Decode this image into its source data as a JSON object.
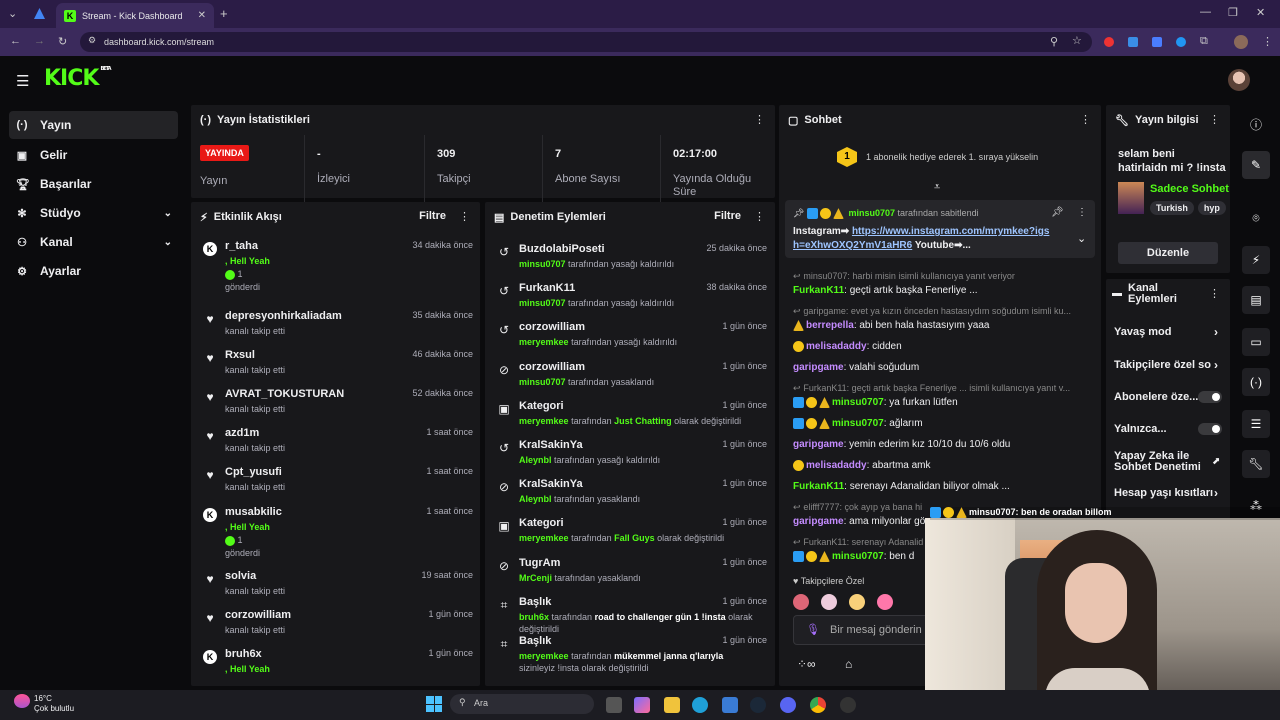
{
  "browser": {
    "tab_title": "Stream - Kick Dashboard",
    "url": "dashboard.kick.com/stream"
  },
  "logo": {
    "text": "KICK",
    "beta": "BETA"
  },
  "sidebar": {
    "items": [
      {
        "label": "Yayın",
        "icon": "broadcast-icon",
        "active": true
      },
      {
        "label": "Gelir",
        "icon": "wallet-icon"
      },
      {
        "label": "Başarılar",
        "icon": "trophy-icon"
      },
      {
        "label": "Stüdyo",
        "icon": "gear-icon",
        "expandable": true
      },
      {
        "label": "Kanal",
        "icon": "user-group-icon",
        "expandable": true
      },
      {
        "label": "Ayarlar",
        "icon": "settings-icon",
        "expandable": true
      }
    ]
  },
  "stats": {
    "title": "Yayın İstatistikleri",
    "live_badge": "YAYINDA",
    "items": [
      {
        "value": "",
        "label": "Yayın"
      },
      {
        "value": "-",
        "label": "İzleyici"
      },
      {
        "value": "309",
        "label": "Takipçi"
      },
      {
        "value": "7",
        "label": "Abone Sayısı"
      },
      {
        "value": "02:17:00",
        "label": "Yayında Olduğu Süre"
      }
    ]
  },
  "activity": {
    "title": "Etkinlik Akışı",
    "filter": "Filtre",
    "events": [
      {
        "name": "r_taha",
        "time": "34 dakika önce",
        "sub": ", Hell Yeah",
        "extra": "1",
        "extra2": "gönderdi",
        "icon": "kick-icon"
      },
      {
        "name": "depresyonhirkaliadam",
        "time": "35 dakika önce",
        "sub": "kanalı takip etti",
        "icon": "heart-icon"
      },
      {
        "name": "Rxsul",
        "time": "46 dakika önce",
        "sub": "kanalı takip etti",
        "icon": "heart-icon"
      },
      {
        "name": "AVRAT_TOKUSTURAN",
        "time": "52 dakika önce",
        "sub": "kanalı takip etti",
        "icon": "heart-icon"
      },
      {
        "name": "azd1m",
        "time": "1 saat önce",
        "sub": "kanalı takip etti",
        "icon": "heart-icon"
      },
      {
        "name": "Cpt_yusufi",
        "time": "1 saat önce",
        "sub": "kanalı takip etti",
        "icon": "heart-icon"
      },
      {
        "name": "musabkilic",
        "time": "1 saat önce",
        "sub": ", Hell Yeah",
        "extra": "1",
        "extra2": "gönderdi",
        "icon": "kick-icon"
      },
      {
        "name": "solvia",
        "time": "19 saat önce",
        "sub": "kanalı takip etti",
        "icon": "heart-icon"
      },
      {
        "name": "corzowilliam",
        "time": "1 gün önce",
        "sub": "kanalı takip etti",
        "icon": "heart-icon"
      },
      {
        "name": "bruh6x",
        "time": "1 gün önce",
        "sub": ", Hell Yeah",
        "icon": "kick-icon"
      }
    ]
  },
  "moderation": {
    "title": "Denetim Eylemleri",
    "filter": "Filtre",
    "actions": [
      {
        "name": "BuzdolabiPoseti",
        "time": "25 dakika önce",
        "actor": "minsu0707",
        "text": "tarafından yasağı kaldırıldı",
        "icon": "undo-icon"
      },
      {
        "name": "FurkanK11",
        "time": "38 dakika önce",
        "actor": "minsu0707",
        "text": "tarafından yasağı kaldırıldı",
        "icon": "undo-icon"
      },
      {
        "name": "corzowilliam",
        "time": "1 gün önce",
        "actor": "meryemkee",
        "text": "tarafından yasağı kaldırıldı",
        "icon": "undo-icon"
      },
      {
        "name": "corzowilliam",
        "time": "1 gün önce",
        "actor": "minsu0707",
        "text": "tarafından yasaklandı",
        "icon": "ban-icon"
      },
      {
        "name": "Kategori",
        "time": "1 gün önce",
        "actor": "meryemkee",
        "text": "tarafından",
        "hl": "Just Chatting",
        "text2": "olarak değiştirildi",
        "icon": "category-icon"
      },
      {
        "name": "KralSakinYa",
        "time": "1 gün önce",
        "actor": "Aleynbl",
        "text": "tarafından yasağı kaldırıldı",
        "icon": "undo-icon"
      },
      {
        "name": "KralSakinYa",
        "time": "1 gün önce",
        "actor": "Aleynbl",
        "text": "tarafından yasaklandı",
        "icon": "ban-icon"
      },
      {
        "name": "Kategori",
        "time": "1 gün önce",
        "actor": "meryemkee",
        "text": "tarafından",
        "hl": "Fall Guys",
        "text2": "olarak değiştirildi",
        "icon": "category-icon"
      },
      {
        "name": "TugrAm",
        "time": "1 gün önce",
        "actor": "MrCenji",
        "text": "tarafından yasaklandı",
        "icon": "ban-icon"
      },
      {
        "name": "Başlık",
        "time": "1 gün önce",
        "actor": "bruh6x",
        "text": "tarafından",
        "hl": "road to challenger gün 1 !insta",
        "text2": "olarak",
        "line2": "değiştirildi",
        "icon": "title-icon"
      },
      {
        "name": "Başlık",
        "time": "1 gün önce",
        "actor": "meryemkee",
        "text": "tarafından",
        "hl": "mükemmel janna q'larıyla",
        "text2": "",
        "line2": "sizinleyiz !insta olarak değiştirildi",
        "icon": "title-icon"
      }
    ]
  },
  "chat": {
    "title": "Sohbet",
    "gift_notice": "1 abonelik hediye ederek 1. sıraya yükselin",
    "pinned_by": "minsu0707",
    "pinned_text": "tarafından sabitlendi",
    "pinned_msg_prefix": "Instagram➡",
    "pinned_link": "https://www.instagram.com/mrymkee?igsh=eXhwOXQ2YmV1aHR6",
    "pinned_suffix": "Youtube➡...",
    "lines": [
      {
        "reply": "minsu0707: harbi misin isimli kullanıcıya yanıt veriyor"
      },
      {
        "user": "FurkanK11",
        "color": "#53fc18",
        "msg": "geçti artık başka Fenerliye ..."
      },
      {
        "reply": "garipgame: evet ya kızın önceden hastasıydım soğudum isimli ku..."
      },
      {
        "user": "berrepella",
        "color": "#c48cff",
        "msg": "abi ben hala hastasıyım yaaa",
        "badges": [
          "warn"
        ]
      },
      {
        "user": "melisadaddy",
        "color": "#c48cff",
        "msg": "cidden",
        "badges": [
          "crown"
        ]
      },
      {
        "user": "garipgame",
        "color": "#c48cff",
        "msg": "valahi soğudum"
      },
      {
        "reply": "FurkanK11: geçti artık başka Fenerliye ... isimli kullanıcıya yanıt v..."
      },
      {
        "user": "minsu0707",
        "color": "#53fc18",
        "msg": "ya furkan lütfen",
        "badges": [
          "mod",
          "gold",
          "warn"
        ]
      },
      {
        "user": "minsu0707",
        "color": "#53fc18",
        "msg": "ağlarım",
        "badges": [
          "mod",
          "gold",
          "warn"
        ]
      },
      {
        "user": "garipgame",
        "color": "#c48cff",
        "msg": "yemin ederim kız 10/10 du 10/6 oldu"
      },
      {
        "user": "melisadaddy",
        "color": "#c48cff",
        "msg": "abartma amk",
        "badges": [
          "crown"
        ]
      },
      {
        "user": "FurkanK11",
        "color": "#53fc18",
        "msg": "serenayı Adanalidan biliyor olmak ..."
      },
      {
        "reply": "elifff7777: çok ayıp ya bana hi"
      },
      {
        "user": "garipgame",
        "color": "#c48cff",
        "msg": "ama milyonlar gö"
      },
      {
        "reply": "FurkanK11: serenayı Adanalid"
      },
      {
        "user": "minsu0707",
        "color": "#53fc18",
        "msg": "ben d",
        "badges": [
          "mod",
          "gold",
          "warn"
        ]
      }
    ],
    "followers_only": "Takipçilere Özel",
    "input_placeholder": "Bir mesaj gönderin",
    "overlay_user": "minsu0707",
    "overlay_msg": ": ben de oradan billom"
  },
  "stream_info": {
    "title": "Yayın bilgisi",
    "stream_title": "selam beni hatirlaidn mi ? !insta",
    "category": "Sadece Sohbet",
    "tags": [
      "Turkish",
      "hyp"
    ],
    "edit": "Düzenle"
  },
  "channel_actions": {
    "title": "Kanal Eylemleri",
    "items": [
      {
        "label": "Yavaş mod",
        "type": "arrow"
      },
      {
        "label": "Takipçilere özel so",
        "type": "arrow"
      },
      {
        "label": "Abonelere öze...",
        "type": "toggle"
      },
      {
        "label": "Yalnızca...",
        "type": "toggle"
      },
      {
        "label": "Yapay Zeka ile Sohbet Denetimi",
        "type": "external"
      },
      {
        "label": "Hesap yaşı kısıtları",
        "type": "arrow"
      }
    ]
  },
  "taskbar": {
    "weather_temp": "16°C",
    "weather_desc": "Çok bulutlu",
    "search": "Ara"
  },
  "colors": {
    "accent": "#53fc18",
    "panel": "#18181b",
    "bg": "#0b0b0d",
    "live": "#e91916"
  }
}
